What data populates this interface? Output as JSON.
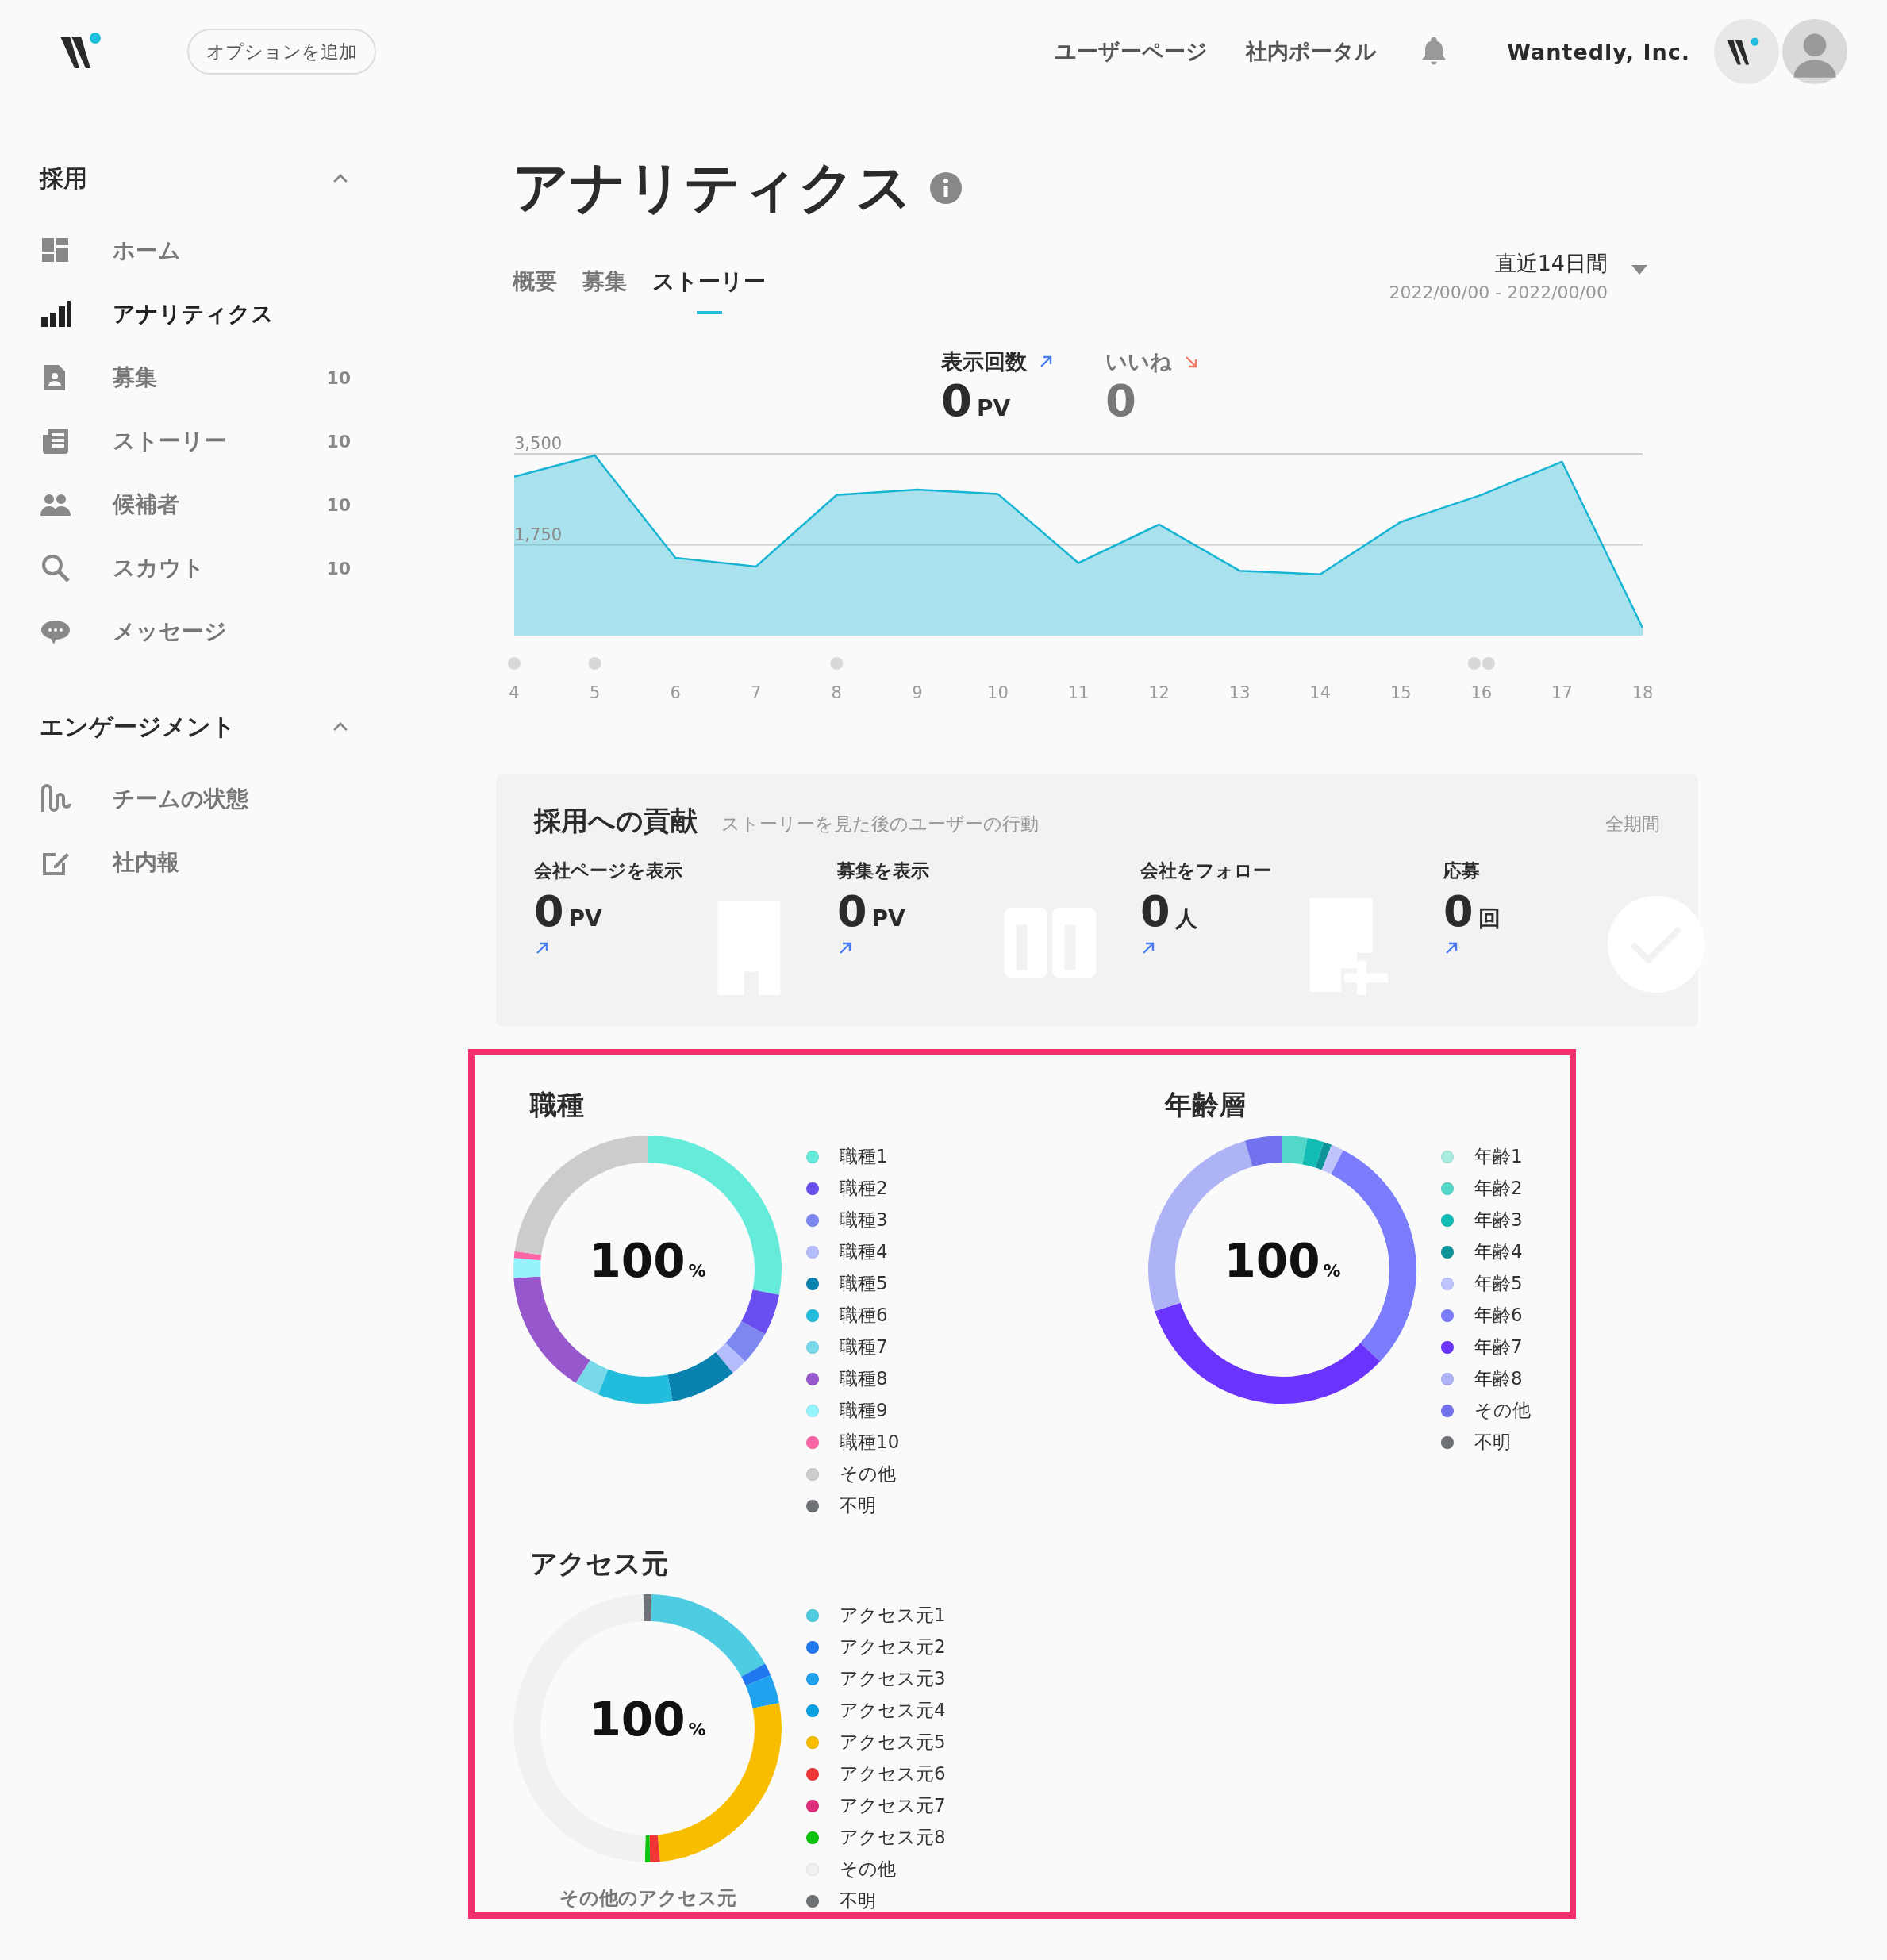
{
  "header": {
    "add_option_button": "オプションを追加",
    "nav_links": [
      "ユーザーページ",
      "社内ポータル"
    ],
    "company": "Wantedly, Inc."
  },
  "sidebar": {
    "sections": [
      {
        "title": "採用",
        "expanded": true,
        "items": [
          {
            "label": "ホーム",
            "kind": "home",
            "selected": false
          },
          {
            "label": "アナリティクス",
            "kind": "analytics",
            "selected": true
          },
          {
            "label": "募集",
            "kind": "badge",
            "selected": false,
            "count": "10"
          },
          {
            "label": "ストーリー",
            "kind": "story",
            "selected": false,
            "count": "10"
          },
          {
            "label": "候補者",
            "kind": "people",
            "selected": false,
            "count": "10"
          },
          {
            "label": "スカウト",
            "kind": "search",
            "selected": false,
            "count": "10"
          },
          {
            "label": "メッセージ",
            "kind": "chat",
            "selected": false
          }
        ]
      },
      {
        "title": "エンゲージメント",
        "expanded": true,
        "items": [
          {
            "label": "チームの状態",
            "kind": "wave",
            "selected": false
          },
          {
            "label": "社内報",
            "kind": "edit",
            "selected": false
          }
        ]
      }
    ]
  },
  "page": {
    "title": "アナリティクス",
    "tabs": [
      {
        "label": "概要",
        "selected": false
      },
      {
        "label": "募集",
        "selected": false
      },
      {
        "label": "ストーリー",
        "selected": true
      }
    ],
    "period": {
      "label": "直近14日間",
      "range": "2022/00/00 - 2022/00/00"
    }
  },
  "metrics": [
    {
      "label": "表示回数",
      "value": "0",
      "unit": "PV",
      "rising": true,
      "selected": true
    },
    {
      "label": "いいね",
      "value": "0",
      "rising": false,
      "selected": false
    }
  ],
  "event_row": [
    {
      "kind": "single"
    },
    {
      "kind": "single"
    },
    {
      "kind": "none"
    },
    {
      "kind": "none"
    },
    {
      "kind": "single"
    },
    {
      "kind": "none"
    },
    {
      "kind": "none"
    },
    {
      "kind": "none"
    },
    {
      "kind": "none"
    },
    {
      "kind": "none"
    },
    {
      "kind": "none"
    },
    {
      "kind": "none"
    },
    {
      "kind": "double"
    },
    {
      "kind": "none"
    },
    {
      "kind": "none"
    }
  ],
  "chart_data": {
    "type": "area",
    "x": [
      4,
      5,
      6,
      7,
      8,
      9,
      10,
      11,
      12,
      13,
      14,
      15,
      16,
      17,
      18
    ],
    "series": [
      {
        "color": "#18b4d4",
        "values": [
          3060,
          3470,
          1500,
          1330,
          2710,
          2810,
          2730,
          1400,
          2140,
          1250,
          1180,
          2190,
          2710,
          3350,
          150
        ]
      }
    ],
    "xlim": [
      4,
      18
    ],
    "ylim": [
      0,
      3500
    ],
    "xticks": [
      4,
      5,
      6,
      7,
      8,
      9,
      10,
      11,
      12,
      13,
      14,
      15,
      16,
      17,
      18
    ],
    "yticks": [
      {
        "value": 1750,
        "label": "1,750"
      },
      {
        "value": 3500,
        "label": "3,500"
      }
    ]
  },
  "contribution": {
    "title": "採用への貢献",
    "subtitle": "ストーリーを見た後のユーザーの行動",
    "period": "全期間",
    "items": [
      {
        "label": "会社ページを表示",
        "value": "0",
        "unit": "PV",
        "kind": "building"
      },
      {
        "label": "募集を表示",
        "value": "0",
        "unit": "PV",
        "kind": "cards"
      },
      {
        "label": "会社をフォロー",
        "value": "0",
        "unit": "人",
        "kind": "follow"
      },
      {
        "label": "応募",
        "value": "0",
        "unit": "回",
        "kind": "check"
      }
    ]
  },
  "breakdowns": [
    {
      "title": "職種",
      "total": "100",
      "unit": "%",
      "legend": [
        {
          "label": "職種1",
          "color": "#64ebd9"
        },
        {
          "label": "職種2",
          "color": "#6a4ef0"
        },
        {
          "label": "職種3",
          "color": "#7c87f0"
        },
        {
          "label": "職種4",
          "color": "#b5befc"
        },
        {
          "label": "職種5",
          "color": "#0a82b0"
        },
        {
          "label": "職種6",
          "color": "#22bcdc"
        },
        {
          "label": "職種7",
          "color": "#78d9e8"
        },
        {
          "label": "職種8",
          "color": "#9658cc"
        },
        {
          "label": "職種9",
          "color": "#96f2fc"
        },
        {
          "label": "職種10",
          "color": "#fc64a8"
        },
        {
          "label": "その他",
          "color": "#cccccc"
        },
        {
          "label": "不明",
          "color": "#6e7175"
        }
      ]
    },
    {
      "title": "年齢層",
      "total": "100",
      "unit": "%",
      "legend": [
        {
          "label": "年齢1",
          "color": "#aaebdf"
        },
        {
          "label": "年齢2",
          "color": "#52d8c8"
        },
        {
          "label": "年齢3",
          "color": "#10bcb4"
        },
        {
          "label": "年齢4",
          "color": "#0d9499"
        },
        {
          "label": "年齢5",
          "color": "#bfc4fc"
        },
        {
          "label": "年齢6",
          "color": "#7b7cfc"
        },
        {
          "label": "年齢7",
          "color": "#6a34fc"
        },
        {
          "label": "年齢8",
          "color": "#adb3f5"
        },
        {
          "label": "その他",
          "color": "#7272ee"
        },
        {
          "label": "不明",
          "color": "#6e7175"
        }
      ]
    },
    {
      "title": "アクセス元",
      "total": "100",
      "unit": "%",
      "caption": "その他のアクセス元",
      "legend": [
        {
          "label": "アクセス元1",
          "color": "#4dcce2"
        },
        {
          "label": "アクセス元2",
          "color": "#1f78ef"
        },
        {
          "label": "アクセス元3",
          "color": "#20a2ef"
        },
        {
          "label": "アクセス元4",
          "color": "#08a0e0"
        },
        {
          "label": "アクセス元5",
          "color": "#f9bd00"
        },
        {
          "label": "アクセス元6",
          "color": "#ef3535"
        },
        {
          "label": "アクセス元7",
          "color": "#de2d7c"
        },
        {
          "label": "アクセス元8",
          "color": "#0cc40c"
        },
        {
          "label": "その他",
          "color": "#f1f1f1"
        },
        {
          "label": "不明",
          "color": "#6e7175"
        }
      ]
    }
  ]
}
